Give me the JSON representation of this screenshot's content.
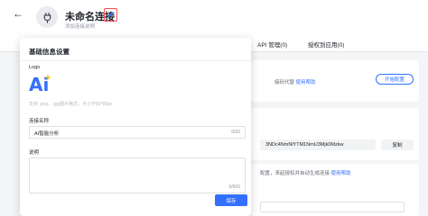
{
  "header": {
    "back_icon": "←",
    "title": "未命名连接",
    "subtitle": "添加连接说明"
  },
  "tabs": [
    {
      "label": "API 管理(0)"
    },
    {
      "label": "授权到应用(0)"
    }
  ],
  "background": {
    "card1_text": "接码代替",
    "card1_link": "使用帮助",
    "card1_button": "开始配置",
    "card2_token": "3NDc4NmNlYTM1NmU3Mjk0Mzkw",
    "card2_copy": "复制",
    "card3_text": "配置，来起授权并自动生成连接",
    "card3_link": "使用帮助"
  },
  "popover": {
    "title": "基础信息设置",
    "logo_label": "Logo",
    "logo_text": "Ai",
    "logo_hint": "支持 .png、.jpg图片格式，不小于80*80px",
    "name_label": "连接名称",
    "name_value": "AI智能分析",
    "name_count": "6/20",
    "desc_label": "说明",
    "desc_value": "",
    "desc_count": "0/600",
    "save_label": "保存"
  },
  "colors": {
    "accent": "#3370ff",
    "edit_border": "#ff4d4f",
    "logo_star": "#f5b800"
  }
}
